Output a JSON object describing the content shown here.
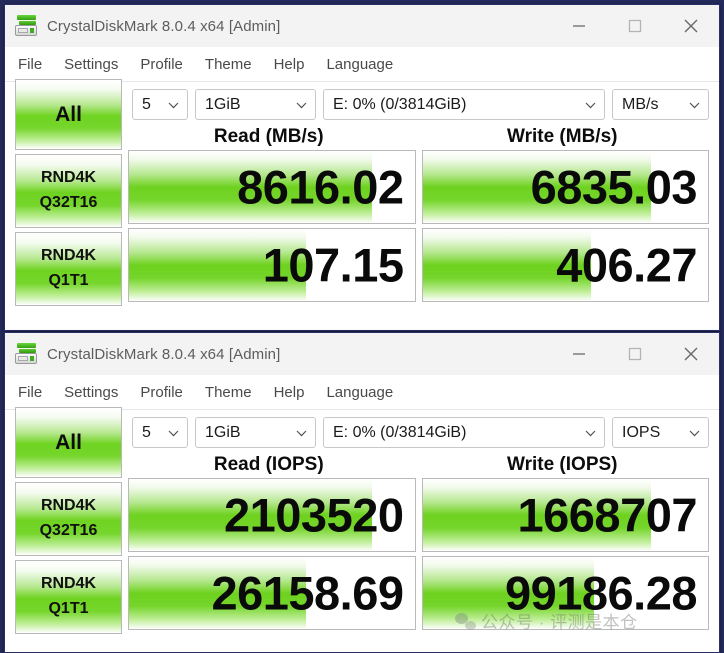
{
  "desktop": {
    "background_color": "#242a5c"
  },
  "windows": [
    {
      "id": "window-mbs",
      "title": "CrystalDiskMark 8.0.4 x64 [Admin]",
      "icon": "crystaldiskmark-disk-icon",
      "controls": {
        "minimize": "minimize-icon",
        "maximize": "maximize-icon",
        "close": "close-icon"
      },
      "menu": [
        "File",
        "Settings",
        "Profile",
        "Theme",
        "Help",
        "Language"
      ],
      "toolbar": {
        "all_button": "All",
        "count": "5",
        "size": "1GiB",
        "drive": "E: 0% (0/3814GiB)",
        "unit": "MB/s"
      },
      "columns": [
        "Read (MB/s)",
        "Write (MB/s)"
      ],
      "rows": [
        {
          "label_line1": "RND4K",
          "label_line2": "Q32T16",
          "read_value": "8616.02",
          "write_value": "6835.03",
          "read_fill_pct": 85,
          "write_fill_pct": 80
        },
        {
          "label_line1": "RND4K",
          "label_line2": "Q1T1",
          "read_value": "107.15",
          "write_value": "406.27",
          "read_fill_pct": 62,
          "write_fill_pct": 59
        }
      ]
    },
    {
      "id": "window-iops",
      "title": "CrystalDiskMark 8.0.4 x64 [Admin]",
      "icon": "crystaldiskmark-disk-icon",
      "controls": {
        "minimize": "minimize-icon",
        "maximize": "maximize-icon",
        "close": "close-icon"
      },
      "menu": [
        "File",
        "Settings",
        "Profile",
        "Theme",
        "Help",
        "Language"
      ],
      "toolbar": {
        "all_button": "All",
        "count": "5",
        "size": "1GiB",
        "drive": "E: 0% (0/3814GiB)",
        "unit": "IOPS"
      },
      "columns": [
        "Read (IOPS)",
        "Write (IOPS)"
      ],
      "rows": [
        {
          "label_line1": "RND4K",
          "label_line2": "Q32T16",
          "read_value": "2103520",
          "write_value": "1668707",
          "read_fill_pct": 85,
          "write_fill_pct": 80
        },
        {
          "label_line1": "RND4K",
          "label_line2": "Q1T1",
          "read_value": "26158.69",
          "write_value": "99186.28",
          "read_fill_pct": 62,
          "write_fill_pct": 60
        }
      ]
    }
  ],
  "watermark": {
    "icon": "wechat-icon",
    "text": "公众号 · 评测是本仓"
  },
  "colors": {
    "bar_green": "#6ed21f",
    "title_text": "#5d5d5d",
    "menu_text": "#4a4a4a",
    "value_text": "#0a0a0a"
  }
}
